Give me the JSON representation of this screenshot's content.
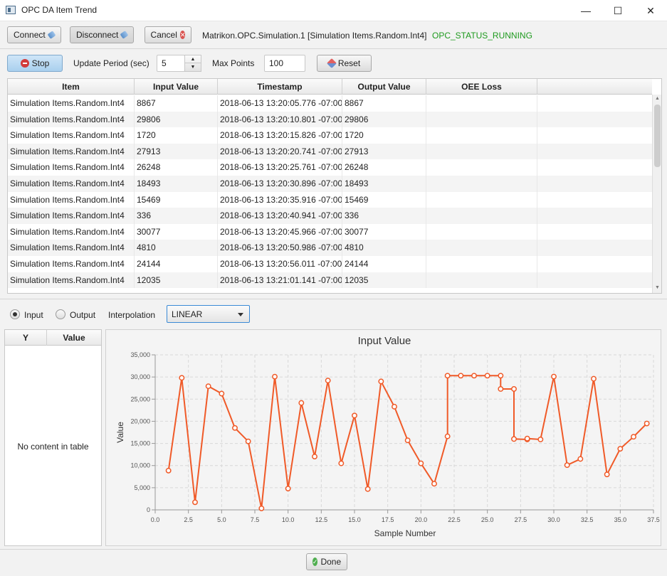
{
  "window": {
    "title": "OPC DA Item Trend",
    "minimize": "—",
    "maximize": "☐",
    "close": "✕"
  },
  "toolbar": {
    "connect_label": "Connect",
    "disconnect_label": "Disconnect",
    "cancel_label": "Cancel",
    "server_item": "Matrikon.OPC.Simulation.1 [Simulation Items.Random.Int4]",
    "status": "OPC_STATUS_RUNNING",
    "status_color": "#1e9a1e"
  },
  "controls": {
    "stop_label": "Stop",
    "update_period_label": "Update Period (sec)",
    "update_period_value": "5",
    "max_points_label": "Max Points",
    "max_points_value": "100",
    "reset_label": "Reset"
  },
  "table": {
    "columns": [
      "Item",
      "Input Value",
      "Timestamp",
      "Output Value",
      "OEE Loss"
    ],
    "rows": [
      [
        "Simulation Items.Random.Int4",
        "8867",
        "2018-06-13 13:20:05.776 -07:00",
        "8867",
        ""
      ],
      [
        "Simulation Items.Random.Int4",
        "29806",
        "2018-06-13 13:20:10.801 -07:00",
        "29806",
        ""
      ],
      [
        "Simulation Items.Random.Int4",
        "1720",
        "2018-06-13 13:20:15.826 -07:00",
        "1720",
        ""
      ],
      [
        "Simulation Items.Random.Int4",
        "27913",
        "2018-06-13 13:20:20.741 -07:00",
        "27913",
        ""
      ],
      [
        "Simulation Items.Random.Int4",
        "26248",
        "2018-06-13 13:20:25.761 -07:00",
        "26248",
        ""
      ],
      [
        "Simulation Items.Random.Int4",
        "18493",
        "2018-06-13 13:20:30.896 -07:00",
        "18493",
        ""
      ],
      [
        "Simulation Items.Random.Int4",
        "15469",
        "2018-06-13 13:20:35.916 -07:00",
        "15469",
        ""
      ],
      [
        "Simulation Items.Random.Int4",
        "336",
        "2018-06-13 13:20:40.941 -07:00",
        "336",
        ""
      ],
      [
        "Simulation Items.Random.Int4",
        "30077",
        "2018-06-13 13:20:45.966 -07:00",
        "30077",
        ""
      ],
      [
        "Simulation Items.Random.Int4",
        "4810",
        "2018-06-13 13:20:50.986 -07:00",
        "4810",
        ""
      ],
      [
        "Simulation Items.Random.Int4",
        "24144",
        "2018-06-13 13:20:56.011 -07:00",
        "24144",
        ""
      ],
      [
        "Simulation Items.Random.Int4",
        "12035",
        "2018-06-13 13:21:01.141 -07:00",
        "12035",
        ""
      ]
    ]
  },
  "trend_options": {
    "input_label": "Input",
    "output_label": "Output",
    "input_selected": true,
    "interpolation_label": "Interpolation",
    "interpolation_value": "LINEAR"
  },
  "y_table": {
    "columns": [
      "Y",
      "Value"
    ],
    "empty_text": "No content in table"
  },
  "footer": {
    "done_label": "Done"
  },
  "chart_data": {
    "type": "line",
    "title": "Input Value",
    "xlabel": "Sample Number",
    "ylabel": "Value",
    "xlim": [
      0,
      37.5
    ],
    "ylim": [
      0,
      35000
    ],
    "xticks": [
      "0.0",
      "2.5",
      "5.0",
      "7.5",
      "10.0",
      "12.5",
      "15.0",
      "17.5",
      "20.0",
      "22.5",
      "25.0",
      "27.5",
      "30.0",
      "32.5",
      "35.0",
      "37.5"
    ],
    "yticks": [
      "0",
      "5,000",
      "10,000",
      "15,000",
      "20,000",
      "25,000",
      "30,000",
      "35,000"
    ],
    "grid": true,
    "line_color": "#f05a28",
    "series": [
      {
        "interpolation": "step",
        "points": [
          [
            1,
            8867
          ],
          [
            2,
            29806
          ],
          [
            3,
            1720
          ],
          [
            4,
            27913
          ],
          [
            5,
            26248
          ],
          [
            6,
            18493
          ],
          [
            7,
            15469
          ],
          [
            8,
            336
          ],
          [
            9,
            30077
          ],
          [
            10,
            4810
          ],
          [
            11,
            24144
          ],
          [
            12,
            12035
          ],
          [
            13,
            29200
          ],
          [
            14,
            10500
          ],
          [
            15,
            21300
          ],
          [
            16,
            4700
          ],
          [
            17,
            29000
          ],
          [
            18,
            23300
          ],
          [
            19,
            15700
          ],
          [
            20,
            10500
          ],
          [
            21,
            5900
          ],
          [
            22,
            16600
          ],
          [
            22,
            30300
          ],
          [
            23,
            30300
          ],
          [
            24,
            30300
          ],
          [
            25,
            30300
          ],
          [
            26,
            30300
          ],
          [
            26,
            27300
          ],
          [
            27,
            27300
          ],
          [
            27,
            16000
          ],
          [
            28,
            15900
          ],
          [
            28,
            16100
          ],
          [
            29,
            15900
          ],
          [
            30,
            30100
          ],
          [
            31,
            10100
          ],
          [
            32,
            11500
          ],
          [
            33,
            29600
          ],
          [
            34,
            8000
          ],
          [
            35,
            13800
          ],
          [
            36,
            16500
          ],
          [
            37,
            19500
          ]
        ]
      }
    ]
  }
}
